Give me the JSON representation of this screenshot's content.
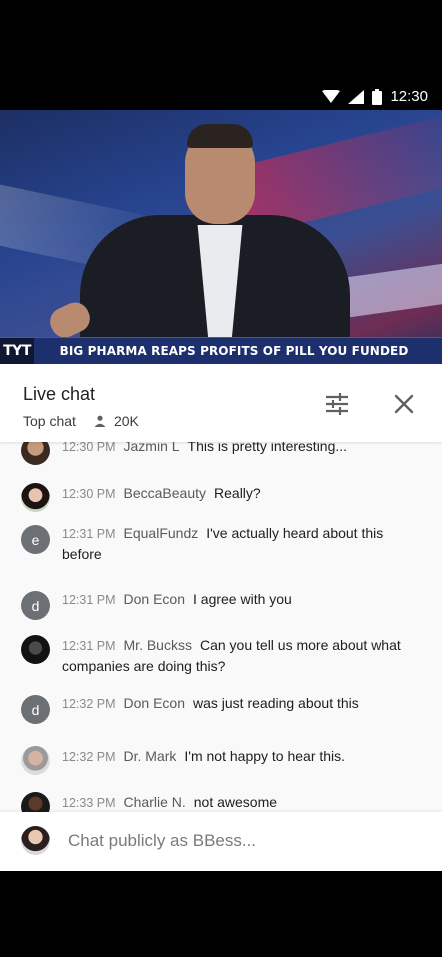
{
  "status_bar": {
    "time": "12:30",
    "icons": [
      "wifi-icon",
      "signal-icon",
      "battery-icon"
    ]
  },
  "video": {
    "channel_logo": "TYT",
    "headline": "BIG PHARMA REAPS PROFITS OF PILL YOU FUNDED"
  },
  "chat": {
    "title": "Live chat",
    "mode": "Top chat",
    "viewer_count": "20K",
    "icons": {
      "filter": "filter-sliders-icon",
      "close": "close-icon",
      "viewers": "person-icon"
    },
    "messages": [
      {
        "time": "12:30 PM",
        "author": "Jazmin L",
        "text": "This is pretty interesting...",
        "avatar": "photo"
      },
      {
        "time": "12:30 PM",
        "author": "BeccaBeauty",
        "text": "Really?",
        "avatar": "photo"
      },
      {
        "time": "12:31 PM",
        "author": "EqualFundz",
        "text": "I've actually heard about this before",
        "avatar": "e"
      },
      {
        "time": "12:31 PM",
        "author": "Don Econ",
        "text": "I agree with you",
        "avatar": "d"
      },
      {
        "time": "12:31 PM",
        "author": "Mr. Buckss",
        "text": "Can you tell us more about what companies are doing this?",
        "avatar": "photo"
      },
      {
        "time": "12:32 PM",
        "author": "Don Econ",
        "text": "was just reading about this",
        "avatar": "d"
      },
      {
        "time": "12:32 PM",
        "author": "Dr. Mark",
        "text": "I'm not happy to hear this.",
        "avatar": "photo"
      },
      {
        "time": "12:33 PM",
        "author": "Charlie N.",
        "text": "not awesome",
        "avatar": "photo"
      }
    ],
    "input_placeholder": "Chat publicly as BBess..."
  }
}
